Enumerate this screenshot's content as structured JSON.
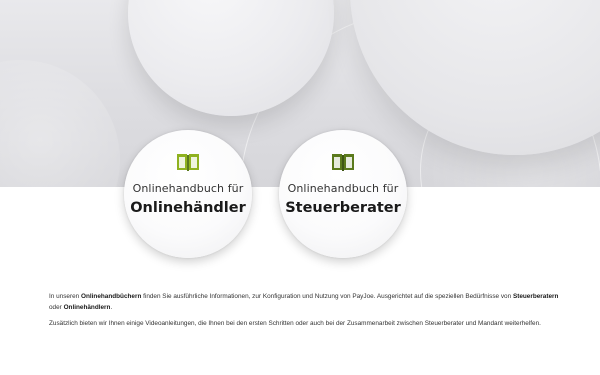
{
  "colors": {
    "accent_green": "#8fb21f",
    "icon_dark_green": "#5b7a1c"
  },
  "cards": [
    {
      "icon": "open-book-icon",
      "subtitle": "Onlinehandbuch für",
      "title": "Onlinehändler"
    },
    {
      "icon": "open-book-icon",
      "subtitle": "Onlinehandbuch für",
      "title": "Steuerberater"
    }
  ],
  "intro": {
    "p1_a": "In unseren ",
    "p1_b": "Onlinehandbüchern",
    "p1_c": " finden Sie ausführliche Informationen, zur Konfiguration und Nutzung von PayJoe. Ausgerichtet auf die speziellen Bedürfnisse von ",
    "p1_d": "Steuerberatern",
    "p1_e": " oder ",
    "p1_f": "Onlinehändlern",
    "p1_g": ".",
    "p2": "Zusätzlich bieten wir Ihnen einige Videoanleitungen, die Ihnen bei den ersten Schritten oder auch bei der Zusammenarbeit zwischen Steuerberater und Mandant weiterhelfen."
  }
}
